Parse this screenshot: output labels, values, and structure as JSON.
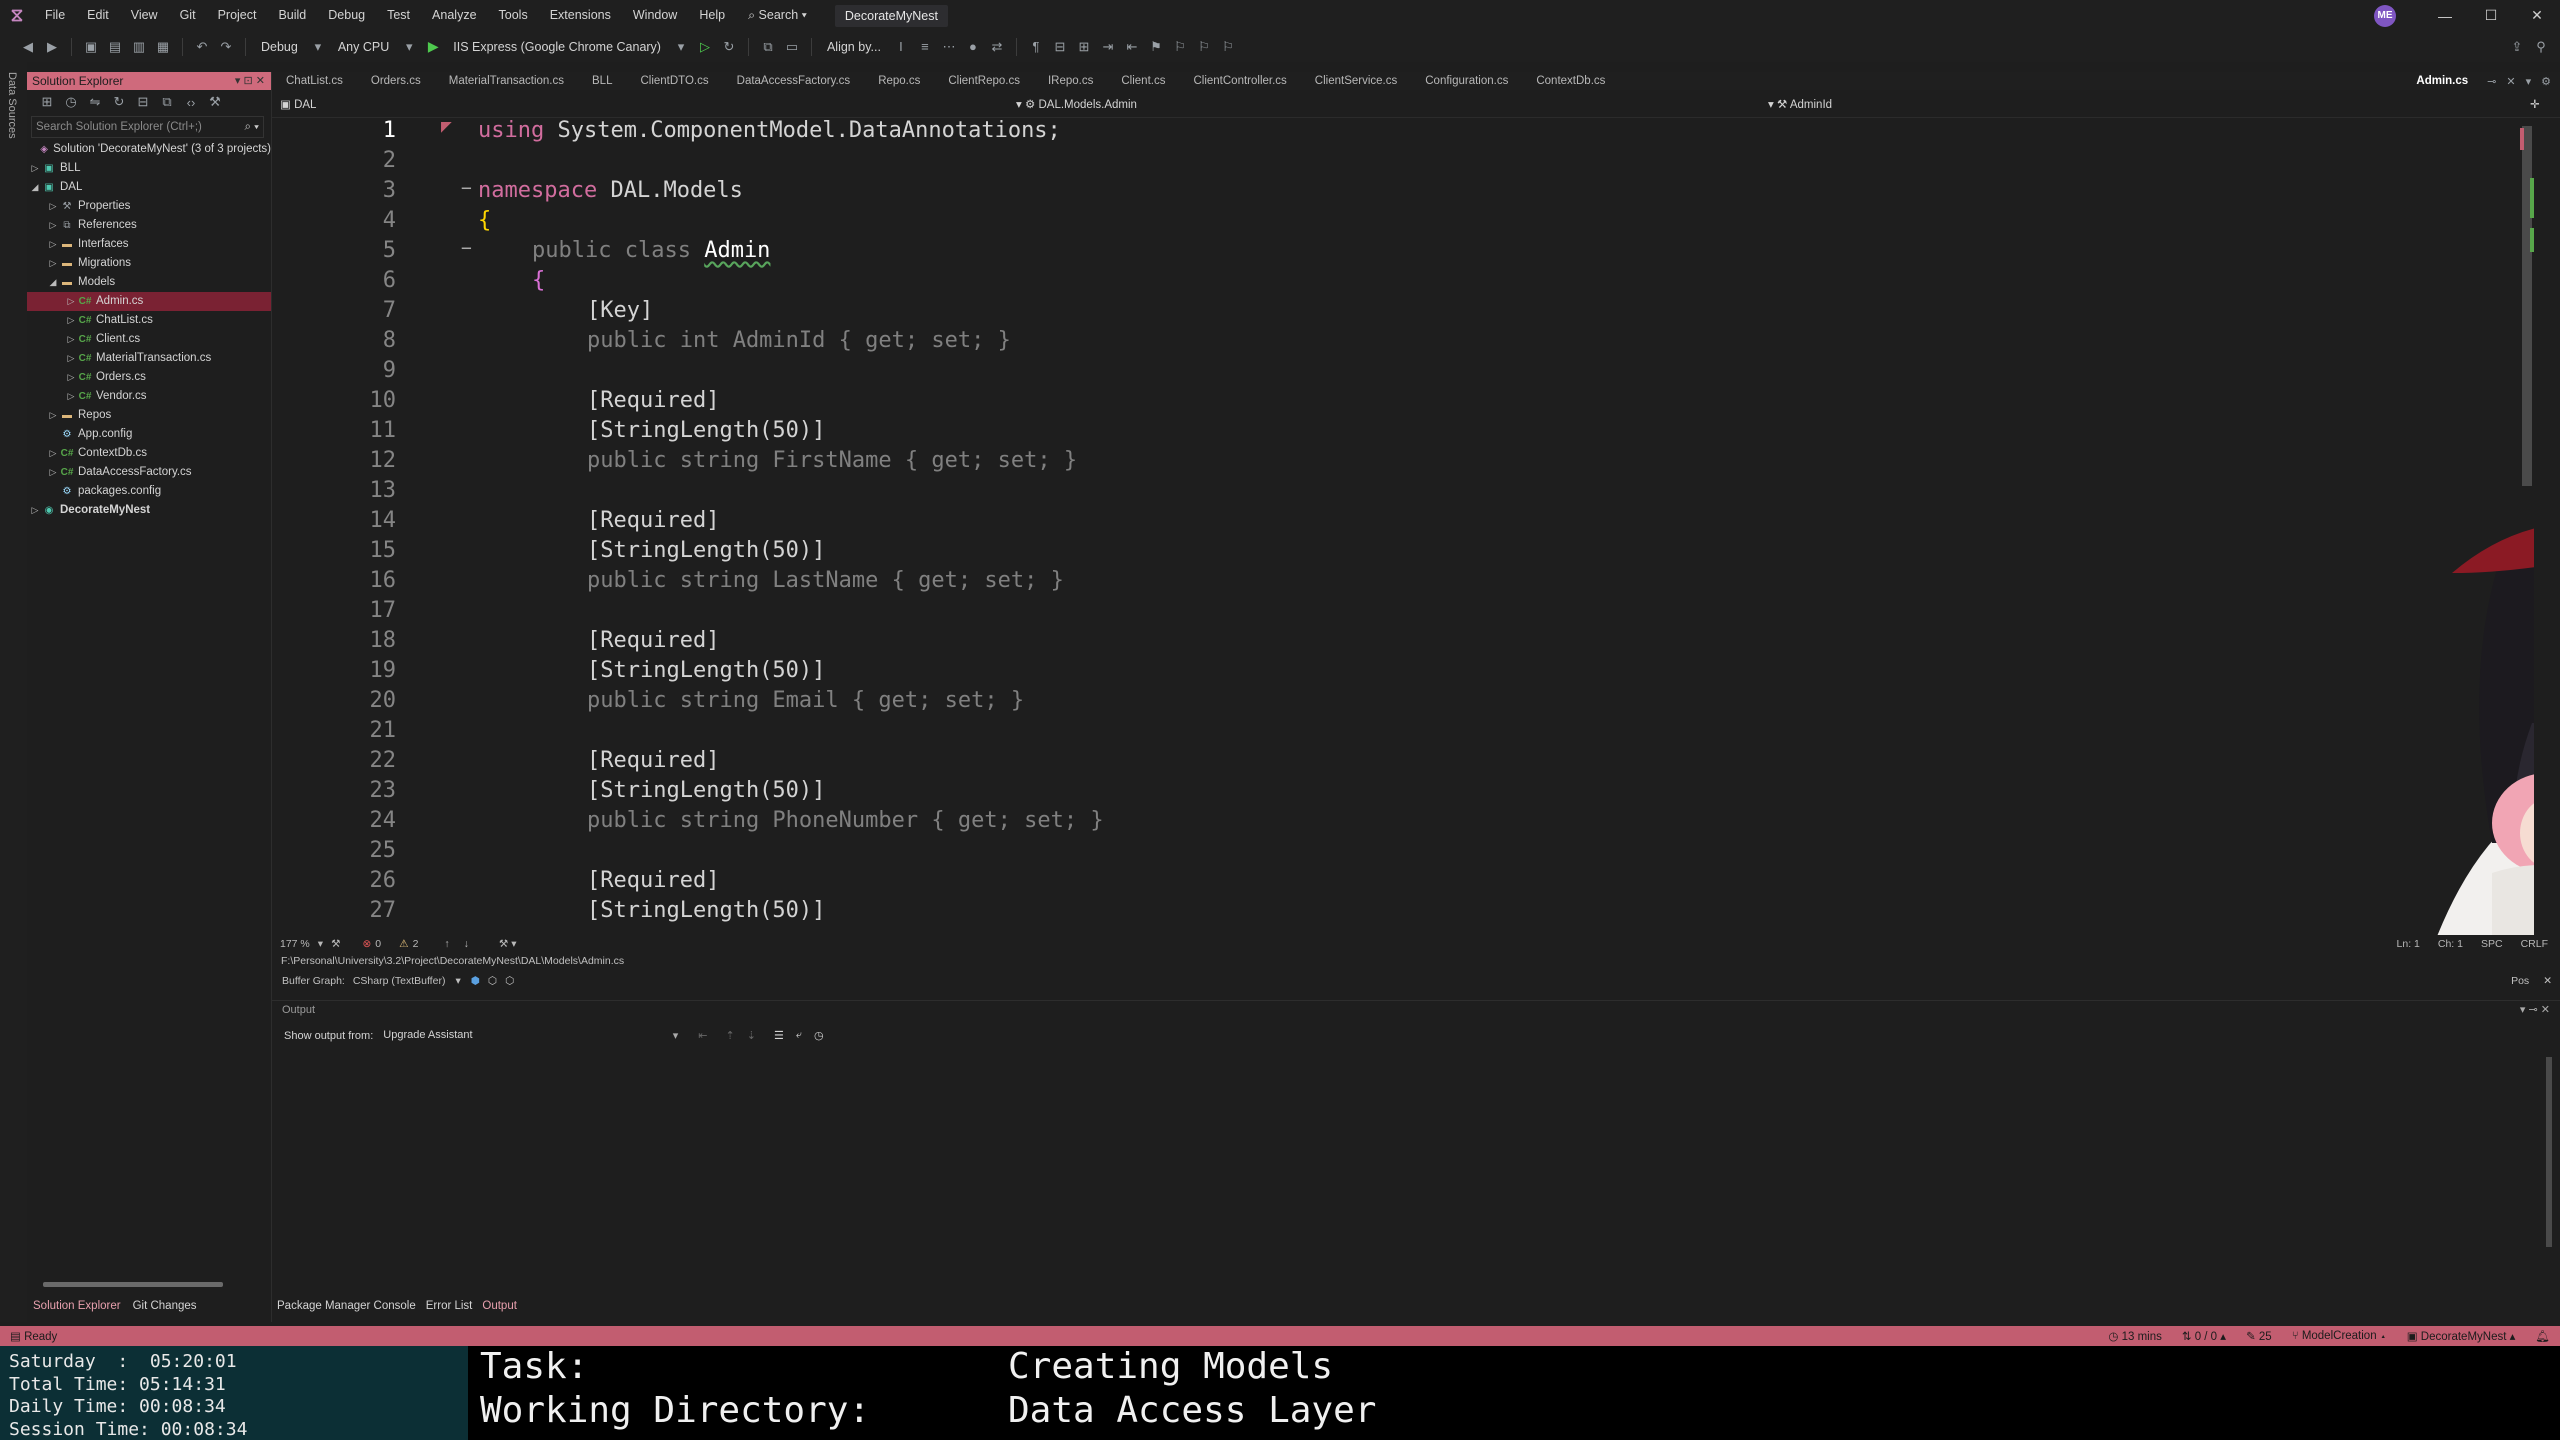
{
  "title_bar": {
    "menu": [
      "File",
      "Edit",
      "View",
      "Git",
      "Project",
      "Build",
      "Debug",
      "Test",
      "Analyze",
      "Tools",
      "Extensions",
      "Window",
      "Help"
    ],
    "search_label": "Search",
    "solution_name": "DecorateMyNest",
    "avatar_initials": "ME"
  },
  "toolbar": {
    "config": "Debug",
    "platform": "Any CPU",
    "run_target": "IIS Express (Google Chrome Canary)",
    "align_by": "Align by..."
  },
  "left_strip": {
    "label": "Data Sources"
  },
  "solution_explorer": {
    "title": "Solution Explorer",
    "search_placeholder": "Search Solution Explorer (Ctrl+;)",
    "tree": [
      {
        "label": "Solution 'DecorateMyNest' (3 of 3 projects)",
        "icon": "solution-icon"
      },
      {
        "label": "BLL",
        "icon": "csproj-icon"
      },
      {
        "label": "DAL",
        "icon": "csproj-icon"
      },
      {
        "label": "Properties",
        "icon": "wrench-icon"
      },
      {
        "label": "References",
        "icon": "references-icon"
      },
      {
        "label": "Interfaces",
        "icon": "folder-icon"
      },
      {
        "label": "Migrations",
        "icon": "folder-icon"
      },
      {
        "label": "Models",
        "icon": "folder-icon"
      },
      {
        "label": "Admin.cs",
        "icon": "csharp-file-icon"
      },
      {
        "label": "ChatList.cs",
        "icon": "csharp-file-icon"
      },
      {
        "label": "Client.cs",
        "icon": "csharp-file-icon"
      },
      {
        "label": "MaterialTransaction.cs",
        "icon": "csharp-file-icon"
      },
      {
        "label": "Orders.cs",
        "icon": "csharp-file-icon"
      },
      {
        "label": "Vendor.cs",
        "icon": "csharp-file-icon"
      },
      {
        "label": "Repos",
        "icon": "folder-icon"
      },
      {
        "label": "App.config",
        "icon": "config-file-icon"
      },
      {
        "label": "ContextDb.cs",
        "icon": "csharp-file-icon"
      },
      {
        "label": "DataAccessFactory.cs",
        "icon": "csharp-file-icon"
      },
      {
        "label": "packages.config",
        "icon": "config-file-icon"
      },
      {
        "label": "DecorateMyNest",
        "icon": "web-project-icon"
      }
    ],
    "bottom_tabs": [
      "Solution Explorer",
      "Git Changes"
    ]
  },
  "tabs": [
    "ChatList.cs",
    "Orders.cs",
    "MaterialTransaction.cs",
    "BLL",
    "ClientDTO.cs",
    "DataAccessFactory.cs",
    "Repo.cs",
    "ClientRepo.cs",
    "IRepo.cs",
    "Client.cs",
    "ClientController.cs",
    "ClientService.cs",
    "Configuration.cs",
    "ContextDb.cs"
  ],
  "active_tab": "Admin.cs",
  "navbar": {
    "project": "DAL",
    "type": "DAL.Models.Admin",
    "member": "AdminId"
  },
  "editor": {
    "line_numbers": [
      "1",
      "2",
      "3",
      "4",
      "5",
      "6",
      "7",
      "8",
      "9",
      "10",
      "11",
      "12",
      "13",
      "14",
      "15",
      "16",
      "17",
      "18",
      "19",
      "20",
      "21",
      "22",
      "23",
      "24",
      "25",
      "26",
      "27"
    ],
    "code": {
      "using_kw": "using",
      "using_ns": "System.ComponentModel.DataAnnotations;",
      "namespace_kw": "namespace",
      "namespace_name": "DAL.Models",
      "open_brace": "{",
      "class_decl_kw": "public class",
      "class_name": "Admin",
      "attr_key": "[Key]",
      "attr_required": "[Required]",
      "attr_stringlength": "[StringLength(50)]",
      "prop_adminid": "public int AdminId { get; set; }",
      "prop_firstname": "public string FirstName { get; set; }",
      "prop_lastname": "public string LastName { get; set; }",
      "prop_email": "public string Email { get; set; }",
      "prop_phone": "public string PhoneNumber { get; set; }"
    }
  },
  "editor_status": {
    "zoom": "177 %",
    "errors": "0",
    "warnings": "2",
    "line": "Ln: 1",
    "col": "Ch: 1",
    "spc": "SPC",
    "crlf": "CRLF"
  },
  "file_path": "F:\\Personal\\University\\3.2\\Project\\DecorateMyNest\\DAL\\Models\\Admin.cs",
  "buffer_graph": {
    "label": "Buffer Graph:",
    "value": "CSharp (TextBuffer)",
    "pos": "Pos"
  },
  "output": {
    "title": "Output",
    "show_from_label": "Show output from:",
    "source": "Upgrade Assistant"
  },
  "bottom_tabs": [
    "Package Manager Console",
    "Error List",
    "Output"
  ],
  "status_bar": {
    "ready": "Ready",
    "time": "13 mins",
    "changes": "0 / 0",
    "edits": "25",
    "branch": "ModelCreation",
    "repo": "DecorateMyNest"
  },
  "overlay": {
    "day_line": "Saturday  :  05:20:01",
    "total_line": "Total Time: 05:14:31",
    "daily_line": "Daily Time: 00:08:34",
    "session_line": "Session Time: 00:08:34",
    "task_label": "Task:",
    "task_value": "Creating Models",
    "dir_label": "Working Directory:",
    "dir_value": "Data Access Layer"
  },
  "colors": {
    "accent": "#c25d70",
    "selection": "#7a2233",
    "overlay_bg": "#0c2f35"
  }
}
